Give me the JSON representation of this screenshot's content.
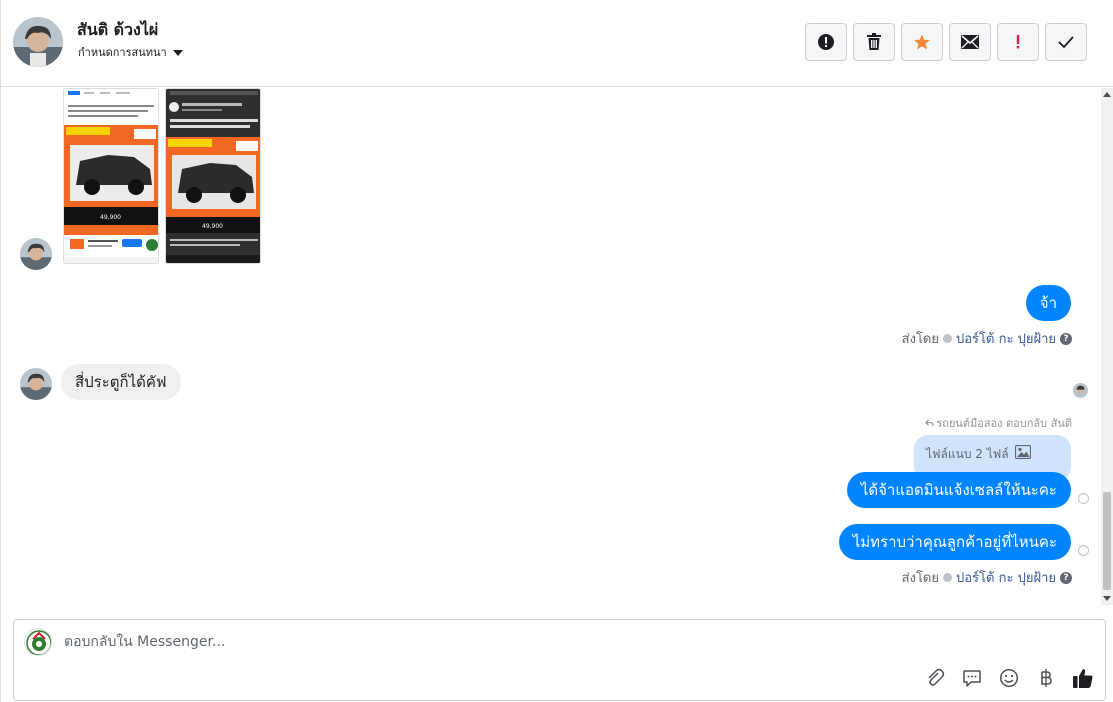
{
  "header": {
    "contact_name": "สันติ ด้วงไผ่",
    "assign_label": "กำหนดการสนทนา",
    "actions": [
      {
        "name": "mark-spam-button",
        "icon": "alert-circle-icon",
        "glyph": "!"
      },
      {
        "name": "delete-button",
        "icon": "trash-icon",
        "glyph": ""
      },
      {
        "name": "star-button",
        "icon": "star-icon",
        "glyph": "★"
      },
      {
        "name": "mark-unread-button",
        "icon": "envelope-icon",
        "glyph": ""
      },
      {
        "name": "mark-important-button",
        "icon": "exclamation-icon",
        "glyph": "!"
      },
      {
        "name": "mark-done-button",
        "icon": "checkmark-icon",
        "glyph": "✓"
      }
    ]
  },
  "thread": {
    "messages": [
      {
        "id": "m1",
        "from": "customer",
        "type": "images",
        "count": 2
      },
      {
        "id": "m2",
        "from": "page",
        "text": "จ้า"
      },
      {
        "id": "m3",
        "from": "customer",
        "text": "สี่ประตูก็ได้คัฟ"
      },
      {
        "id": "m4",
        "from": "page",
        "text": "ได้จ้าแอดมินแจ้งเซลล์ให้นะคะ"
      },
      {
        "id": "m5",
        "from": "page",
        "text": "ไม่ทราบว่าคุณลูกค้าอยู่ที่ไหนคะ"
      }
    ],
    "sent_by_label": "ส่งโดย",
    "agent_name": "ปอร์โต้ กะ ปุยฝ้าย",
    "reply_note": "รถยนต์มือสอง ตอบกลับ สันติ",
    "attachment_label": "ไฟล์แนบ 2 ไฟล์",
    "ad_price_left": "49,900",
    "ad_price_right": "49,900"
  },
  "composer": {
    "placeholder": "ตอบกลับใน Messenger...",
    "tools": [
      "paperclip-icon",
      "speech-bubble-icon",
      "smiley-icon",
      "baht-icon",
      "thumbs-up-icon"
    ]
  },
  "colors": {
    "accent": "#0084ff",
    "customer_bubble": "#f1f0f0",
    "attachment_bubble": "#cfe3fb",
    "star": "#f5883c",
    "important": "#e41e3f"
  }
}
